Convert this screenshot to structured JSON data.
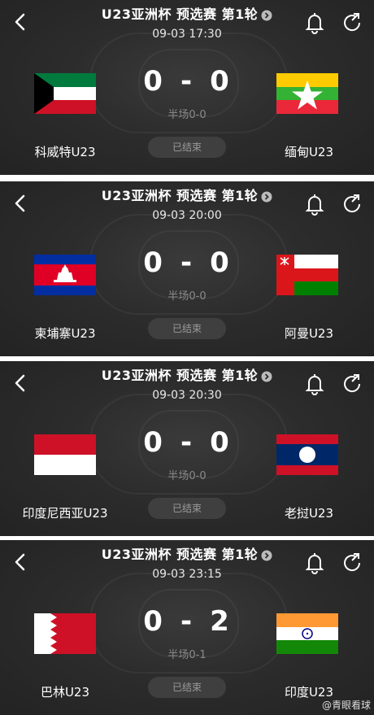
{
  "header": {
    "title": "U23亚洲杯 预选赛 第1轮",
    "icons": [
      "back-arrow-icon",
      "info-arrow-icon",
      "bell-icon",
      "share-icon"
    ]
  },
  "matches": [
    {
      "datetime": "09-03 17:30",
      "home": {
        "name": "科威特U23",
        "flag": "kuwait-flag"
      },
      "away": {
        "name": "缅甸U23",
        "flag": "myanmar-flag"
      },
      "home_score": "0",
      "away_score": "0",
      "separator": "-",
      "half_time": "半场0-0",
      "status": "已结束"
    },
    {
      "datetime": "09-03 20:00",
      "home": {
        "name": "柬埔寨U23",
        "flag": "cambodia-flag"
      },
      "away": {
        "name": "阿曼U23",
        "flag": "oman-flag"
      },
      "home_score": "0",
      "away_score": "0",
      "separator": "-",
      "half_time": "半场0-0",
      "status": "已结束"
    },
    {
      "datetime": "09-03 20:30",
      "home": {
        "name": "印度尼西亚U23",
        "flag": "indonesia-flag"
      },
      "away": {
        "name": "老挝U23",
        "flag": "laos-flag"
      },
      "home_score": "0",
      "away_score": "0",
      "separator": "-",
      "half_time": "半场0-0",
      "status": "已结束"
    },
    {
      "datetime": "09-03 23:15",
      "home": {
        "name": "巴林U23",
        "flag": "bahrain-flag"
      },
      "away": {
        "name": "印度U23",
        "flag": "india-flag"
      },
      "home_score": "0",
      "away_score": "2",
      "separator": "-",
      "half_time": "半场0-1",
      "status": "已结束"
    }
  ],
  "watermark": "@青眼看球",
  "colors": {
    "card_bg": "#2c2c2c",
    "status_bg": "#3f3f3f",
    "muted": "#8a8a8a"
  }
}
